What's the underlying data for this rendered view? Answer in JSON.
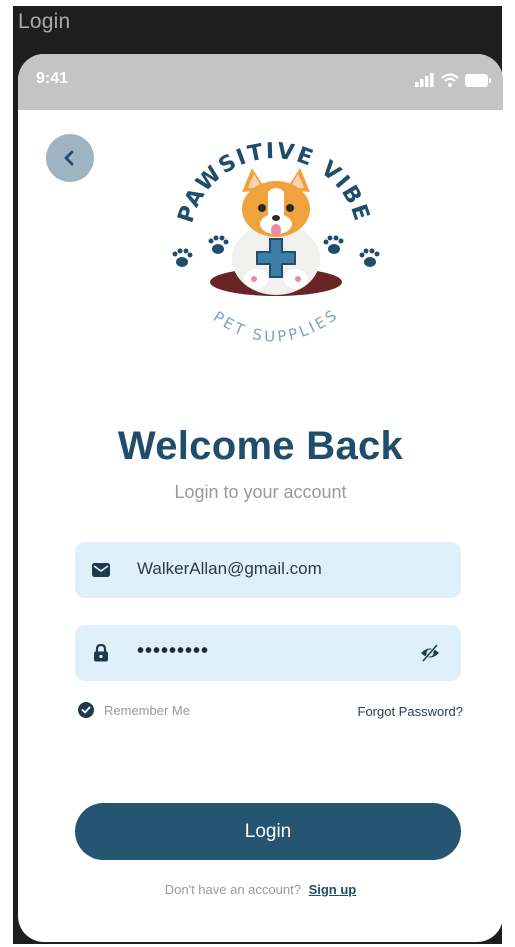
{
  "window": {
    "title": "Login"
  },
  "status_bar": {
    "time": "9:41",
    "icons": [
      "signal-icon",
      "wifi-icon",
      "battery-icon"
    ]
  },
  "back_button": {
    "icon": "chevron-left-icon"
  },
  "logo": {
    "brand_top": "PAWSITIVE VIBES",
    "brand_bottom": "PET SUPPLIES"
  },
  "header": {
    "title": "Welcome Back",
    "subtitle": "Login to your account"
  },
  "email_field": {
    "icon": "mail-icon",
    "value": "WalkerAllan@gmail.com"
  },
  "password_field": {
    "icon": "lock-icon",
    "value": "•••••••••",
    "toggle_icon": "eye-off-icon"
  },
  "remember": {
    "label": "Remember Me",
    "checked": true
  },
  "forgot": {
    "label": "Forgot Password?"
  },
  "login_button": {
    "label": "Login"
  },
  "signup": {
    "question": "Don't have an account?",
    "link": "Sign up"
  },
  "colors": {
    "primary": "#255570",
    "heading": "#1f4d6b",
    "field_bg": "#dff0fb",
    "back_bg": "#9fb4c3",
    "status_bg": "#c4c4c4",
    "frame_bg": "#1e1e1e"
  }
}
